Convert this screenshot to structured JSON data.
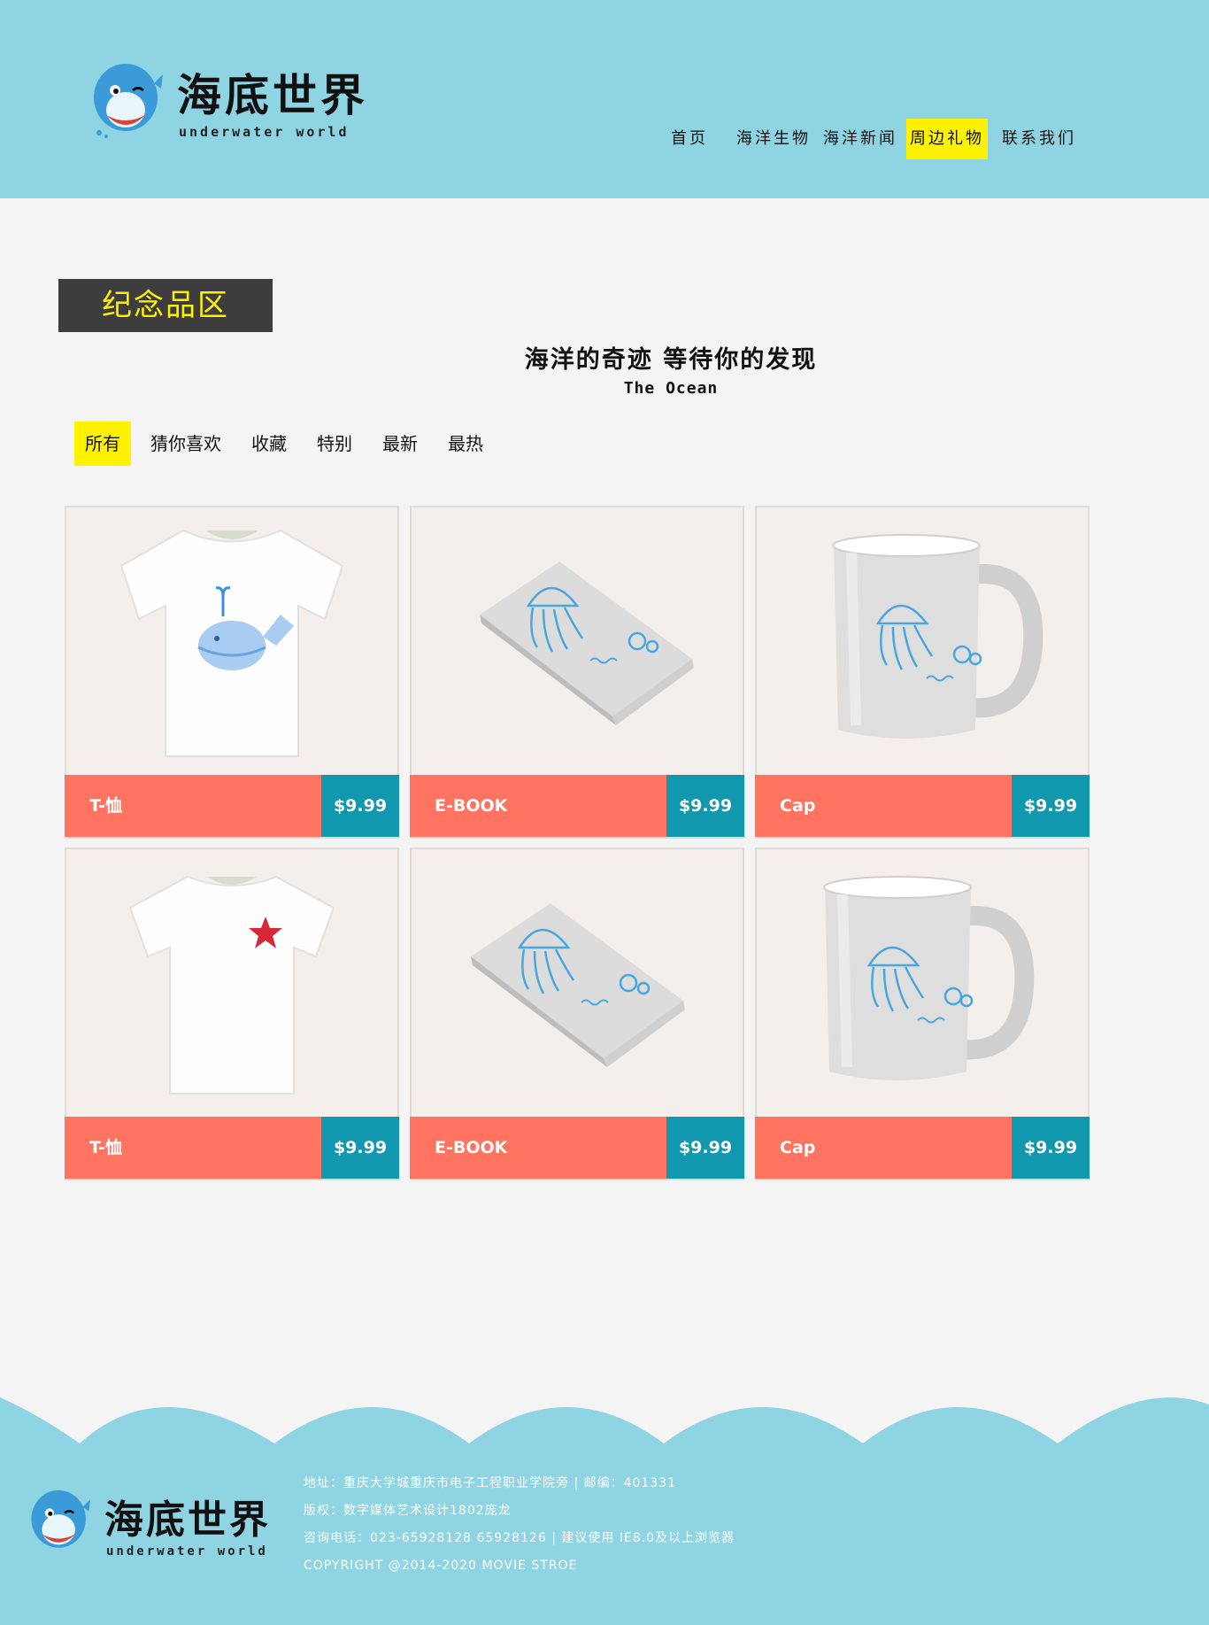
{
  "header": {
    "brand": "海底世界",
    "brand_en": "underwater world",
    "nav": [
      {
        "label": "首页"
      },
      {
        "label": "海洋生物"
      },
      {
        "label": "海洋新闻"
      },
      {
        "label": "周边礼物"
      },
      {
        "label": "联系我们"
      }
    ],
    "active_nav": "周边礼物"
  },
  "section": {
    "tag": "纪念品区",
    "slogan": "海洋的奇迹 等待你的发现",
    "slogan_en": "The Ocean"
  },
  "filters": [
    {
      "label": "所有"
    },
    {
      "label": "猜你喜欢"
    },
    {
      "label": "收藏"
    },
    {
      "label": "特别"
    },
    {
      "label": "最新"
    },
    {
      "label": "最热"
    }
  ],
  "active_filter": "所有",
  "products": [
    {
      "name": "T-恤",
      "price": "$9.99",
      "image": "whale-tshirt-image"
    },
    {
      "name": "E-BOOK",
      "price": "$9.99",
      "image": "jellyfish-book-image"
    },
    {
      "name": "Cap",
      "price": "$9.99",
      "image": "jellyfish-mug-image"
    },
    {
      "name": "T-恤",
      "price": "$9.99",
      "image": "starfish-tshirt-image"
    },
    {
      "name": "E-BOOK",
      "price": "$9.99",
      "image": "jellyfish-book-image"
    },
    {
      "name": "Cap",
      "price": "$9.99",
      "image": "jellyfish-mug-image"
    }
  ],
  "footer": {
    "brand": "海底世界",
    "brand_en": "underwater world",
    "address": "地址：重庆大学城重庆市电子工程职业学院旁 | 邮编：401331",
    "copyright_cn": "版权：数字媒体艺术设计1802庞龙",
    "phone": "咨询电话：023-65928128 65928126 | 建议使用 IE8.0及以上浏览器",
    "copyright_en": "COPYRIGHT @2014-2020 MOVIE STROE"
  },
  "colors": {
    "header_bg": "#8fd4e3",
    "highlight": "#fff200",
    "name_bar": "#fe7460",
    "price_bar": "#1298ae",
    "tag_bg": "#3d3d40"
  }
}
